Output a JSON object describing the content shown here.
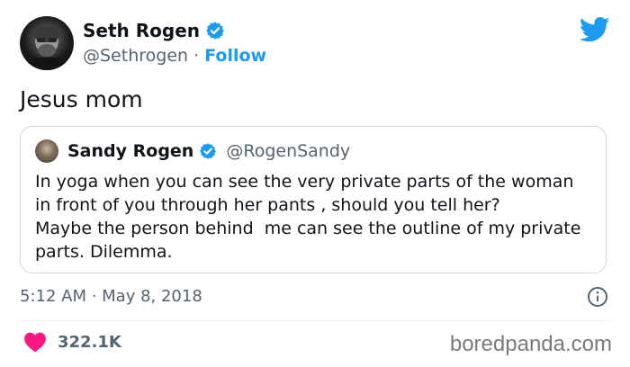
{
  "author": {
    "display_name": "Seth Rogen",
    "handle": "@Sethrogen",
    "separator": "·",
    "follow_label": "Follow",
    "verified_icon": "verified-badge-icon"
  },
  "tweet": {
    "text": "Jesus mom",
    "timestamp": "5:12 AM · May 8, 2018",
    "like_count": "322.1K"
  },
  "quoted_tweet": {
    "display_name": "Sandy Rogen",
    "handle": "@RogenSandy",
    "lines": [
      "In yoga when you can see the very private parts of the woman",
      "in front of you through her pants , should you tell her?",
      "Maybe the person behind  me can see the outline of my private",
      "parts. Dilemma."
    ]
  },
  "watermark": "boredpanda.com",
  "colors": {
    "brand_blue": "#1d9bf0",
    "like_pink": "#f91880",
    "secondary_text": "#536471",
    "border": "#cfd9de"
  }
}
